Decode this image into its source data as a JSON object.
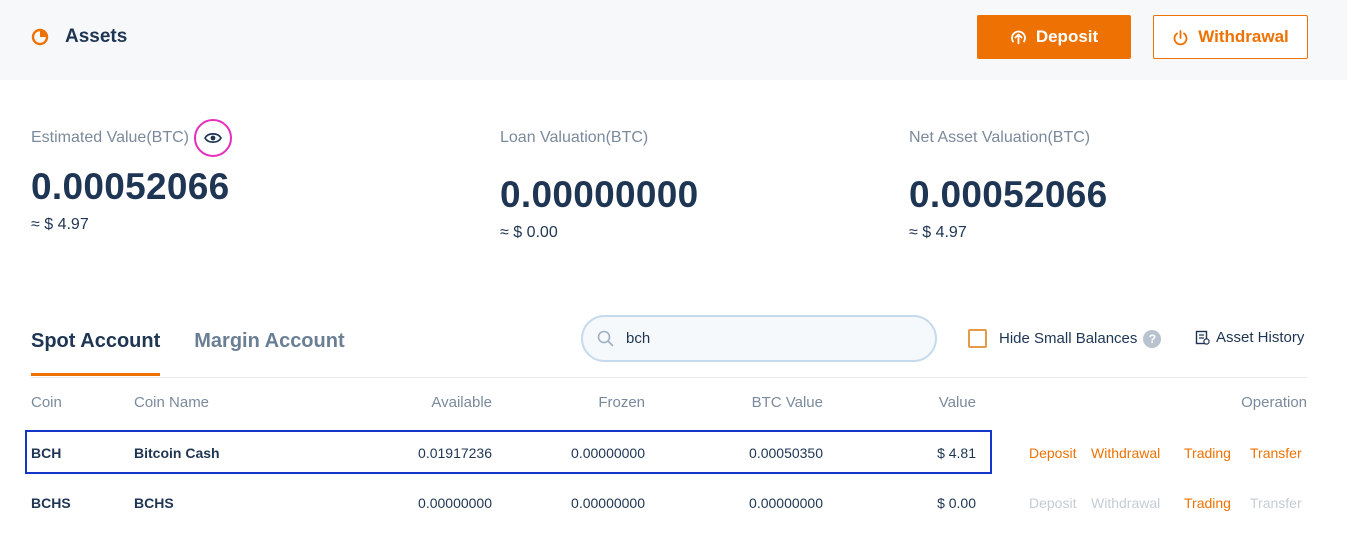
{
  "header": {
    "title": "Assets",
    "deposit_label": "Deposit",
    "withdrawal_label": "Withdrawal"
  },
  "stats": [
    {
      "label": "Estimated Value(BTC)",
      "value": "0.00052066",
      "approx": "≈ $ 4.97"
    },
    {
      "label": "Loan Valuation(BTC)",
      "value": "0.00000000",
      "approx": "≈ $ 0.00"
    },
    {
      "label": "Net Asset Valuation(BTC)",
      "value": "0.00052066",
      "approx": "≈ $ 4.97"
    }
  ],
  "tabs": [
    {
      "label": "Spot Account",
      "active": true
    },
    {
      "label": "Margin Account",
      "active": false
    }
  ],
  "search": {
    "value": "bch",
    "placeholder": ""
  },
  "hide_small_balances": {
    "label": "Hide Small Balances",
    "checked": false,
    "help": "?"
  },
  "asset_history_label": "Asset History",
  "table": {
    "headers": {
      "coin": "Coin",
      "coin_name": "Coin Name",
      "available": "Available",
      "frozen": "Frozen",
      "btc_value": "BTC Value",
      "value": "Value",
      "operation": "Operation"
    },
    "rows": [
      {
        "coin": "BCH",
        "coin_name": "Bitcoin Cash",
        "available": "0.01917236",
        "frozen": "0.00000000",
        "btc_value": "0.00050350",
        "value": "$ 4.81",
        "ops": {
          "deposit": "Deposit",
          "withdrawal": "Withdrawal",
          "trading": "Trading",
          "transfer": "Transfer"
        }
      },
      {
        "coin": "BCHS",
        "coin_name": "BCHS",
        "available": "0.00000000",
        "frozen": "0.00000000",
        "btc_value": "0.00000000",
        "value": "$ 0.00",
        "ops": {
          "deposit": "Deposit",
          "withdrawal": "Withdrawal",
          "trading": "Trading",
          "transfer": "Transfer"
        }
      }
    ]
  },
  "colors": {
    "accent": "#ee7203",
    "text": "#1e3553",
    "muted": "#7b8a9c",
    "disabled": "#c4ccd6",
    "highlight_ring": "#e62fbd",
    "selection_box": "#1534c8"
  }
}
